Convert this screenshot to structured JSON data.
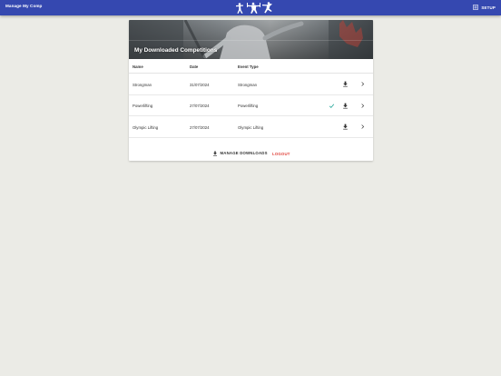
{
  "appbar": {
    "title": "Manage My Comp",
    "setup_label": "SETUP",
    "color": "#3548b0"
  },
  "card": {
    "title": "My Downloaded Competitions",
    "columns": [
      "Name",
      "Date",
      "Event Type"
    ],
    "rows": [
      {
        "name": "Strongman",
        "date": "31/07/2024",
        "event_type": "Strongman",
        "downloaded": false
      },
      {
        "name": "Powerlifting",
        "date": "27/07/2024",
        "event_type": "Powerlifting",
        "downloaded": true
      },
      {
        "name": "Olympic Lifting",
        "date": "27/07/2024",
        "event_type": "Olympic Lifting",
        "downloaded": false
      }
    ],
    "icons": {
      "check": "check-icon",
      "download": "download-icon",
      "chevron": "chevron-right-icon"
    },
    "manage_downloads_label": "MANAGE DOWNLOADS",
    "logout_label": "LOGOUT",
    "logout_color": "#e0443c",
    "check_color": "#26a69a"
  }
}
